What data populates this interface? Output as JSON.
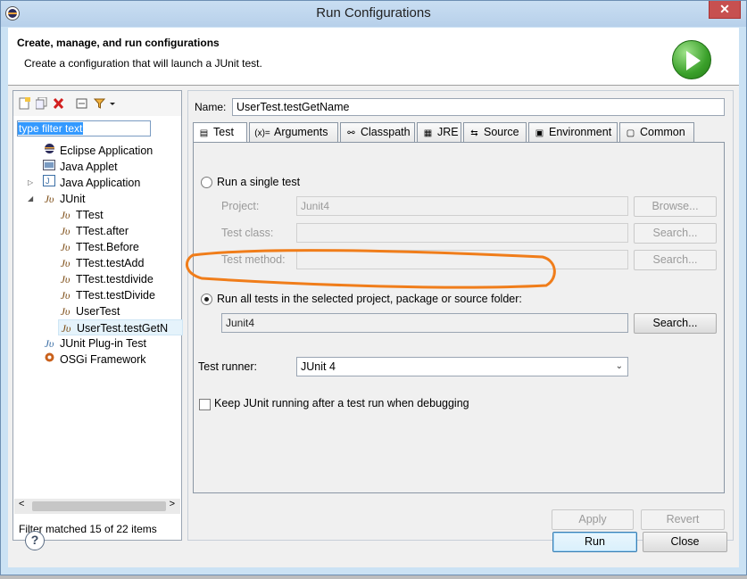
{
  "window": {
    "title": "Run Configurations",
    "close_glyph": "✕"
  },
  "header": {
    "title": "Create, manage, and run configurations",
    "subtitle": "Create a configuration that will launch a JUnit test."
  },
  "left": {
    "filter_value": "type filter text",
    "tree": [
      {
        "label": "Eclipse Application",
        "icon": "eclipse-icon",
        "level": 1,
        "expander": ""
      },
      {
        "label": "Java Applet",
        "icon": "applet-icon",
        "level": 1,
        "expander": ""
      },
      {
        "label": "Java Application",
        "icon": "java-app-icon",
        "level": 1,
        "expander": "▷"
      },
      {
        "label": "JUnit",
        "icon": "junit-icon",
        "level": 1,
        "expander": "◢"
      },
      {
        "label": "TTest",
        "icon": "junit-icon",
        "level": 2
      },
      {
        "label": "TTest.after",
        "icon": "junit-icon",
        "level": 2
      },
      {
        "label": "TTest.Before",
        "icon": "junit-icon",
        "level": 2
      },
      {
        "label": "TTest.testAdd",
        "icon": "junit-icon",
        "level": 2
      },
      {
        "label": "TTest.testdivide",
        "icon": "junit-icon",
        "level": 2
      },
      {
        "label": "TTest.testDivide",
        "icon": "junit-icon",
        "level": 2
      },
      {
        "label": "UserTest",
        "icon": "junit-icon",
        "level": 2
      },
      {
        "label": "UserTest.testGetN",
        "icon": "junit-icon",
        "level": 2,
        "selected": true
      },
      {
        "label": "JUnit Plug-in Test",
        "icon": "junit-plugin-icon",
        "level": 1,
        "expander": ""
      },
      {
        "label": "OSGi Framework",
        "icon": "osgi-icon",
        "level": 1,
        "expander": ""
      }
    ],
    "junit_glyph": "Jυ",
    "scroll_left": "<",
    "scroll_right": ">",
    "filter_status": "Filter matched 15 of 22 items"
  },
  "right": {
    "name_label": "Name:",
    "name_value": "UserTest.testGetName",
    "tabs": [
      {
        "label": "Test",
        "glyph": "▤"
      },
      {
        "label": "Arguments",
        "glyph": "(x)="
      },
      {
        "label": "Classpath",
        "glyph": "⚯"
      },
      {
        "label": "JRE",
        "glyph": "▦"
      },
      {
        "label": "Source",
        "glyph": "⇆"
      },
      {
        "label": "Environment",
        "glyph": "▣"
      },
      {
        "label": "Common",
        "glyph": "▢"
      }
    ],
    "single_test_label": "Run a single test",
    "project_label": "Project:",
    "project_value": "Junit4",
    "browse_label": "Browse...",
    "test_class_label": "Test class:",
    "test_method_label": "Test method:",
    "search_label": "Search...",
    "run_all_label": "Run all tests in the selected project, package or source folder:",
    "run_all_value": "Junit4",
    "runner_label": "Test runner:",
    "runner_value": "JUnit 4",
    "keep_running_label": "Keep JUnit running after a test run when debugging",
    "apply_label": "Apply",
    "revert_label": "Revert"
  },
  "footer": {
    "help_glyph": "?",
    "run_label": "Run",
    "close_label": "Close"
  },
  "colors": {
    "annotation": "#f07d1a",
    "title_bar": "#c9def2",
    "close_button": "#c75050"
  }
}
